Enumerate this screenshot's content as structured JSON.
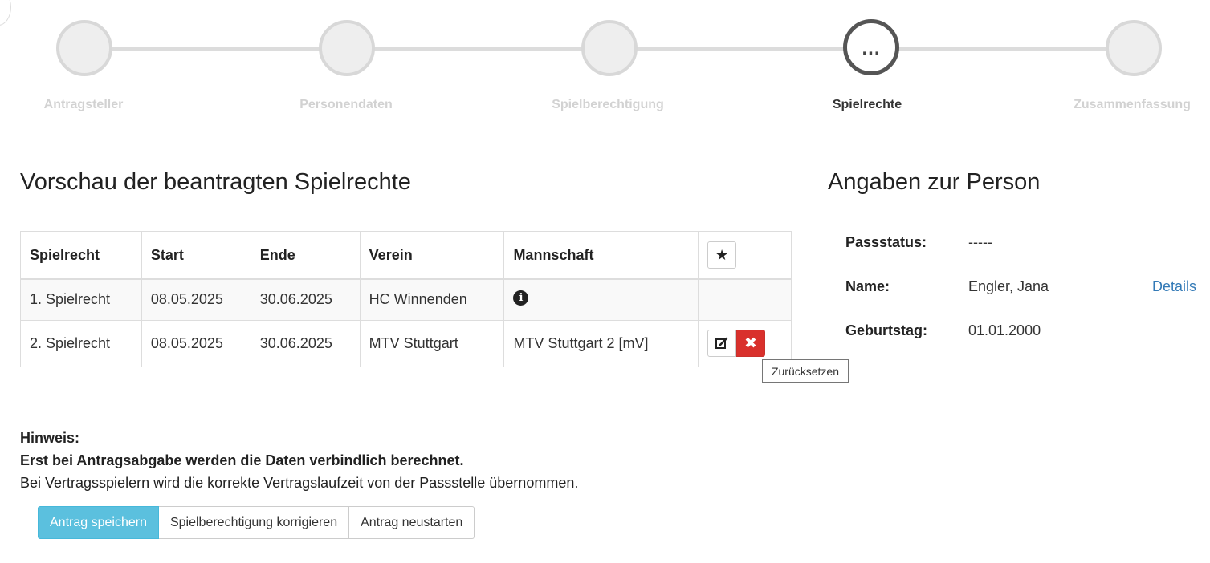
{
  "stepper": {
    "steps": [
      {
        "label": "Antragsteller"
      },
      {
        "label": "Personendaten"
      },
      {
        "label": "Spielberechtigung"
      },
      {
        "label": "Spielrechte",
        "indicator": "..."
      },
      {
        "label": "Zusammenfassung"
      }
    ]
  },
  "main": {
    "title": "Vorschau der beantragten Spielrechte",
    "table": {
      "headers": [
        "Spielrecht",
        "Start",
        "Ende",
        "Verein",
        "Mannschaft"
      ],
      "rows": [
        {
          "spielrecht": "1. Spielrecht",
          "start": "08.05.2025",
          "ende": "30.06.2025",
          "verein": "HC Winnenden",
          "mannschaft": ""
        },
        {
          "spielrecht": "2. Spielrecht",
          "start": "08.05.2025",
          "ende": "30.06.2025",
          "verein": "MTV Stuttgart",
          "mannschaft": "MTV Stuttgart 2 [mV]"
        }
      ]
    },
    "tooltip": "Zurücksetzen"
  },
  "person": {
    "title": "Angaben zur Person",
    "passstatus_label": "Passstatus:",
    "passstatus_value": "-----",
    "name_label": "Name:",
    "name_value": "Engler, Jana",
    "details_link": "Details",
    "birthday_label": "Geburtstag:",
    "birthday_value": "01.01.2000"
  },
  "hint": {
    "heading": "Hinweis:",
    "bold_text": "Erst bei Antragsabgabe werden die Daten verbindlich berechnet.",
    "text": "Bei Vertragsspielern wird die korrekte Vertragslaufzeit von der Passstelle übernommen."
  },
  "actions": {
    "save_label": "Antrag speichern",
    "correct_label": "Spielberechtigung korrigieren",
    "restart_label": "Antrag neustarten"
  },
  "colors": {
    "primary": "#5bc0de",
    "danger": "#d9302c",
    "link": "#337ab7"
  }
}
